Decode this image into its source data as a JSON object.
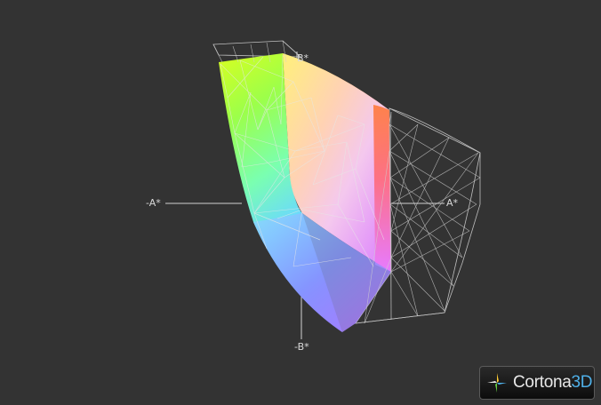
{
  "viewer": {
    "background_color": "#333333",
    "axis_color": "#d0d0d0",
    "wireframe_color": "#d8d8d8"
  },
  "axes": {
    "neg_a": "-A*",
    "pos_a": "A*",
    "pos_b": "B*",
    "neg_b": "-B*"
  },
  "brand": {
    "name": "Cortona",
    "suffix": "3D",
    "accent_color": "#4fb0e8",
    "icon": "cortona-logo-icon"
  },
  "gamut_colors": [
    "#e5ff2a",
    "#ffd95a",
    "#ff8a3a",
    "#ff5a6a",
    "#f07aff",
    "#7a7aff",
    "#6ad8ff",
    "#8aff9a"
  ]
}
